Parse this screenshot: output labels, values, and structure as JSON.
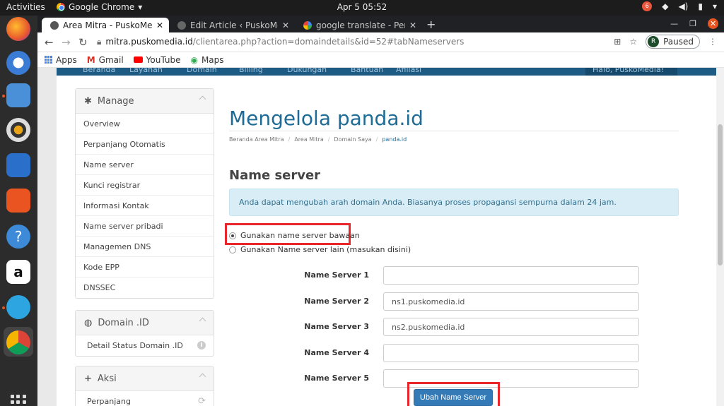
{
  "topbar": {
    "activities": "Activities",
    "app_name": "Google Chrome",
    "clock": "Apr 5  05:52",
    "badge": "6"
  },
  "browser": {
    "tabs": [
      {
        "label": "Area Mitra - PuskoMedia I"
      },
      {
        "label": "Edit Article ‹ PuskoMedia I"
      },
      {
        "label": "google translate - Penelu"
      }
    ],
    "url_host": "mitra.puskomedia.id",
    "url_path": "/clientarea.php?action=domaindetails&id=52#tabNameservers",
    "profile_initial": "R",
    "profile_status": "Paused",
    "bookmarks": [
      {
        "label": "Apps"
      },
      {
        "label": "Gmail"
      },
      {
        "label": "YouTube"
      },
      {
        "label": "Maps"
      }
    ]
  },
  "sitenav": {
    "items": [
      "Beranda",
      "Layanan",
      "Domain",
      "Billing",
      "Dukungan",
      "Bantuan",
      "Afiliasi"
    ],
    "user": "Halo, PuskoMedia!"
  },
  "sidebar": {
    "manage_title": "Manage",
    "manage_items": [
      "Overview",
      "Perpanjang Otomatis",
      "Name server",
      "Kunci registrar",
      "Informasi Kontak",
      "Name server pribadi",
      "Managemen DNS",
      "Kode EPP",
      "DNSSEC"
    ],
    "domain_title": "Domain .ID",
    "domain_items": [
      "Detail Status Domain .ID"
    ],
    "aksi_title": "Aksi",
    "aksi_items": [
      "Perpanjang"
    ]
  },
  "main": {
    "title": "Mengelola panda.id",
    "breadcrumbs": [
      "Beranda Area Mitra",
      "Area Mitra",
      "Domain Saya",
      "panda.id"
    ],
    "section_title": "Name server",
    "alert": "Anda dapat mengubah arah domain Anda. Biasanya proses propagansi sempurna dalam 24 jam.",
    "radio_default": "Gunakan name server bawaan",
    "radio_custom": "Gunakan Name server lain (masukan disini)",
    "nameservers": [
      {
        "label": "Name Server 1",
        "value": ""
      },
      {
        "label": "Name Server 2",
        "value": "ns1.puskomedia.id"
      },
      {
        "label": "Name Server 3",
        "value": "ns2.puskomedia.id"
      },
      {
        "label": "Name Server 4",
        "value": ""
      },
      {
        "label": "Name Server 5",
        "value": ""
      }
    ],
    "submit": "Ubah Name Server"
  },
  "colors": {
    "brand_blue": "#1d6b96",
    "nav_blue": "#1d5b85",
    "button_blue": "#337ab7",
    "highlight_red": "#e8262b",
    "alert_bg": "#d9edf7"
  }
}
